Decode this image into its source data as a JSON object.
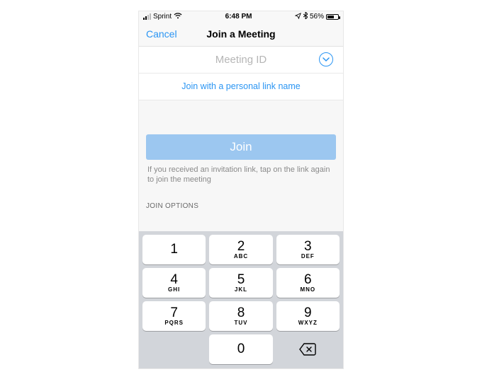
{
  "status": {
    "carrier": "Sprint",
    "time": "6:48 PM",
    "battery_pct": "56%"
  },
  "nav": {
    "cancel": "Cancel",
    "title": "Join a Meeting"
  },
  "meeting_input": {
    "placeholder": "Meeting ID",
    "value": ""
  },
  "personal_link_label": "Join with a personal link name",
  "join": {
    "button_label": "Join",
    "hint": "If you received an invitation link, tap on the link again to join the meeting"
  },
  "options_header": "JOIN OPTIONS",
  "keypad": {
    "keys": [
      {
        "num": "1",
        "sub": ""
      },
      {
        "num": "2",
        "sub": "ABC"
      },
      {
        "num": "3",
        "sub": "DEF"
      },
      {
        "num": "4",
        "sub": "GHI"
      },
      {
        "num": "5",
        "sub": "JKL"
      },
      {
        "num": "6",
        "sub": "MNO"
      },
      {
        "num": "7",
        "sub": "PQRS"
      },
      {
        "num": "8",
        "sub": "TUV"
      },
      {
        "num": "9",
        "sub": "WXYZ"
      },
      {
        "num": "0",
        "sub": ""
      }
    ]
  }
}
